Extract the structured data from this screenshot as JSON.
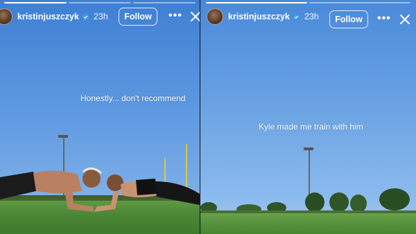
{
  "stories": [
    {
      "username": "kristinjuszczyk",
      "time": "23h",
      "follow_label": "Follow",
      "caption": "Honestly... don't recommend",
      "progress": {
        "segments": 3,
        "completed": 1
      }
    },
    {
      "username": "kristinjuszczyk",
      "time": "23h",
      "follow_label": "Follow",
      "caption": "Kyle made me train with him",
      "progress": {
        "segments": 2,
        "completed": 1
      }
    }
  ],
  "icons": {
    "verified": "verified-badge-icon",
    "more": "more-options-icon",
    "close": "close-icon"
  },
  "colors": {
    "verified_badge": "#3897f0",
    "sky_top": "#3f7fd3",
    "grass": "#4b8836"
  }
}
